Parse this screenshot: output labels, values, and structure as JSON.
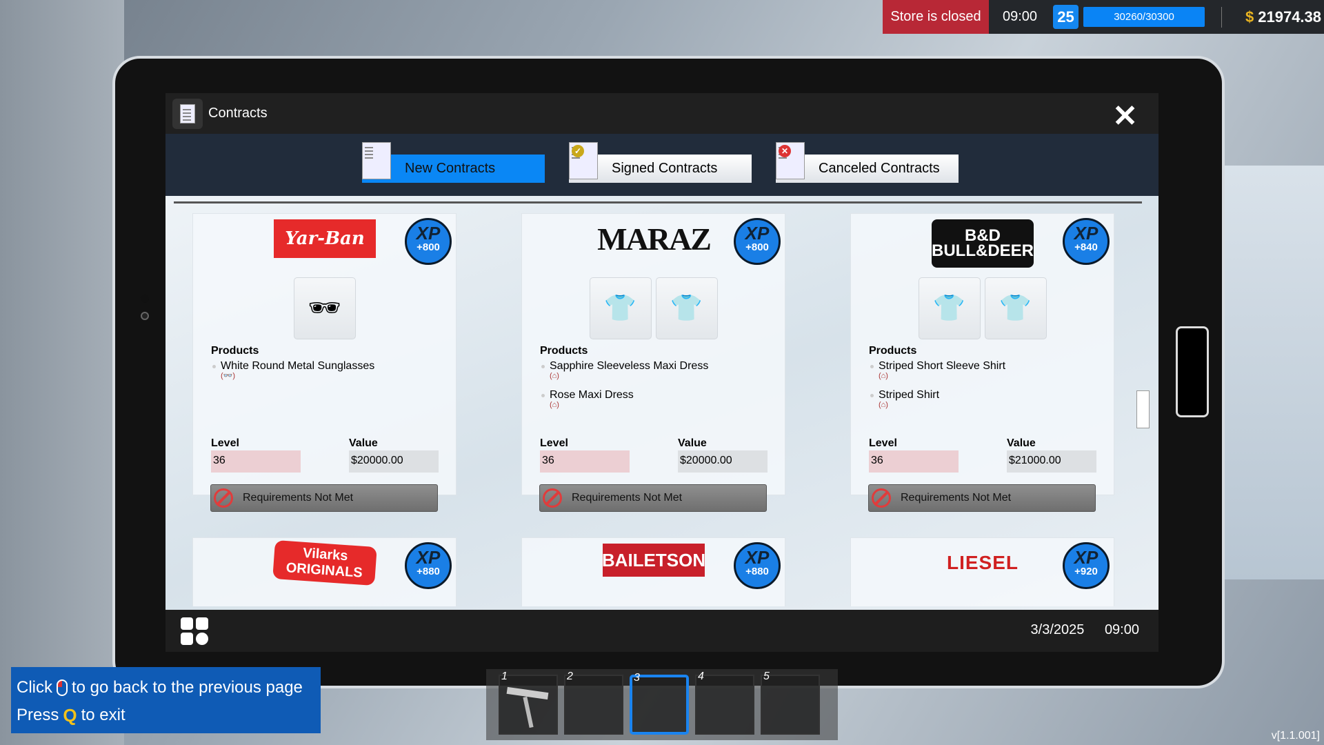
{
  "hud": {
    "store_status": "Store is closed",
    "time": "09:00",
    "level": "25",
    "xp": "30260/30300",
    "currency": "$",
    "money": "21974.38",
    "status_color": "#b82836",
    "accent": "#0a87f5"
  },
  "window": {
    "title": "Contracts",
    "close_icon": "close-icon"
  },
  "tabs": [
    {
      "label": "New Contracts",
      "active": true
    },
    {
      "label": "Signed Contracts",
      "active": false,
      "icon": "check-badge-icon"
    },
    {
      "label": "Canceled Contracts",
      "active": false,
      "icon": "x-badge-icon"
    }
  ],
  "labels": {
    "products": "Products",
    "level": "Level",
    "value": "Value",
    "requirements": "Requirements Not Met"
  },
  "contracts": [
    {
      "brand": "Yar-Ban",
      "xp": "+800",
      "products": [
        {
          "name": "White Round Metal Sunglasses",
          "icon": "sunglasses-icon"
        }
      ],
      "level": "36",
      "value": "$20000.00"
    },
    {
      "brand": "MARAZ",
      "xp": "+800",
      "products": [
        {
          "name": "Sapphire Sleeveless Maxi Dress",
          "icon": "hanger-icon"
        },
        {
          "name": "Rose Maxi Dress",
          "icon": "hanger-icon"
        }
      ],
      "level": "36",
      "value": "$20000.00"
    },
    {
      "brand": "B&D BULL&DEER",
      "xp": "+840",
      "products": [
        {
          "name": "Striped Short Sleeve Shirt",
          "icon": "hanger-icon"
        },
        {
          "name": "Striped Shirt",
          "icon": "hanger-icon"
        }
      ],
      "level": "36",
      "value": "$21000.00"
    },
    {
      "brand": "Vilarks ORIGINALS",
      "xp": "+880"
    },
    {
      "brand": "BAILETSON",
      "xp": "+880"
    },
    {
      "brand": "LIESEL",
      "xp": "+920"
    }
  ],
  "footer": {
    "date": "3/3/2025",
    "time": "09:00"
  },
  "help": {
    "line1_pre": "Click",
    "line1_post": "to go back to the previous page",
    "line2_pre": "Press",
    "key": "Q",
    "line2_post": "to exit"
  },
  "hotbar": [
    "1",
    "2",
    "3",
    "4",
    "5"
  ],
  "hotbar_selected": "3",
  "version": "v[1.1.001]"
}
